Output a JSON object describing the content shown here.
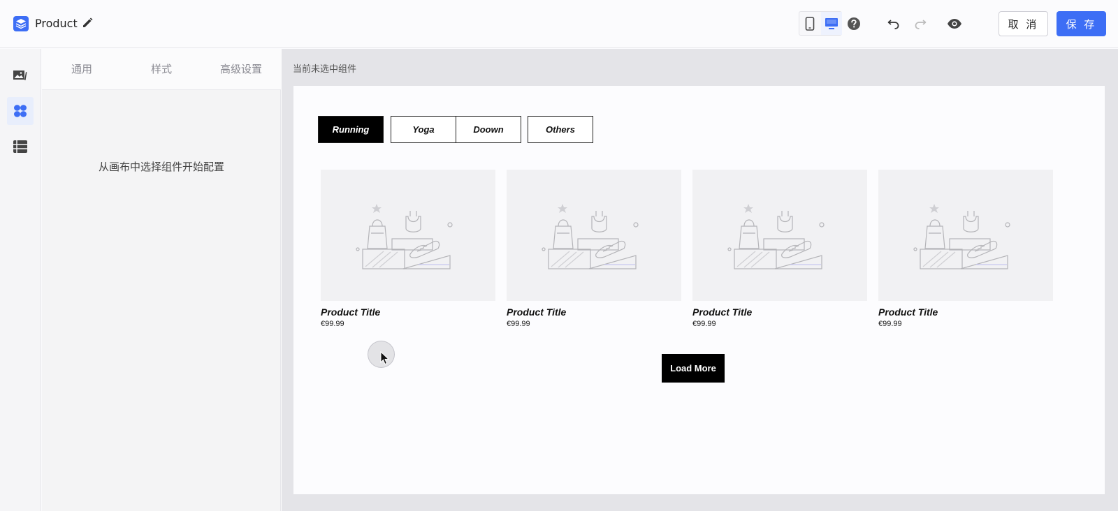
{
  "header": {
    "title": "Product",
    "cancel_label": "取 消",
    "save_label": "保 存"
  },
  "panel": {
    "tabs": [
      {
        "label": "通用"
      },
      {
        "label": "样式"
      },
      {
        "label": "高级设置"
      }
    ],
    "hint": "从画布中选择组件开始配置"
  },
  "canvas": {
    "status": "当前未选中组件",
    "filters": [
      {
        "label": "Running",
        "active": true
      },
      {
        "label": "Yoga",
        "active": false
      },
      {
        "label": "Doown",
        "active": false
      },
      {
        "label": "Others",
        "active": false
      }
    ],
    "products": [
      {
        "title": "Product Title",
        "price": "€99.99"
      },
      {
        "title": "Product Title",
        "price": "€99.99"
      },
      {
        "title": "Product Title",
        "price": "€99.99"
      },
      {
        "title": "Product Title",
        "price": "€99.99"
      }
    ],
    "load_more_label": "Load More"
  },
  "colors": {
    "accent": "#3d6ef5",
    "filter_active_bg": "#000000",
    "canvas_bg": "#e4e4e8"
  },
  "icons": {
    "logo": "layers-icon",
    "edit": "pencil-icon",
    "mobile": "mobile-icon",
    "desktop": "desktop-icon",
    "help": "help-icon",
    "undo": "undo-icon",
    "redo": "redo-icon",
    "preview": "eye-icon",
    "rail": [
      "image-icon",
      "components-icon",
      "list-icon"
    ]
  }
}
